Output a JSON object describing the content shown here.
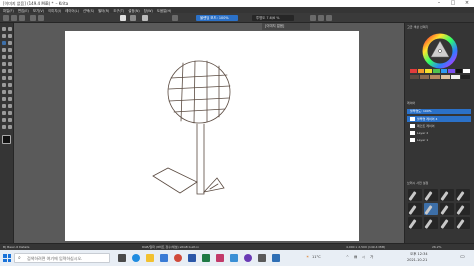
{
  "window": {
    "title": "[이미지 없음] (149.4 MiB) *",
    "app_name": "Krita",
    "controls": [
      "–",
      "□",
      "×"
    ]
  },
  "menubar": [
    "파일(F)",
    "편집(E)",
    "보기(V)",
    "이미지(I)",
    "레이어(L)",
    "선택(S)",
    "필터(R)",
    "도구(T)",
    "설정(N)",
    "창(W)",
    "도움말(H)"
  ],
  "toolbar": {
    "blend_mode": "블렌딩 모드: 100%",
    "opacity_label": "투명도 7.6/6 %"
  },
  "document": {
    "tab_label": "[이미지 없음]"
  },
  "right_panel": {
    "color_selector_title": "고급 색상 선택기",
    "layers_title": "레이어",
    "layer_slider": "불투명도: 100%",
    "layers": [
      {
        "name": "불투명 레이어 4",
        "active": true
      },
      {
        "name": "페인트 레이어",
        "active": false
      },
      {
        "name": "Layer 2",
        "active": false
      },
      {
        "name": "Layer 1",
        "active": false
      }
    ],
    "brush_presets_title": "브러시 사전 설정"
  },
  "statusbar": {
    "left": "B) Basic-6 Details",
    "center": "RGB/알파 (8비트 정수/채널) sRGB built-in",
    "right": "4,000 x 2,500 (149.4 MiB)",
    "zoom": "26.2%"
  },
  "taskbar": {
    "search_placeholder": "검색하려면 여기에 입력하십시오.",
    "weather": "11°C",
    "clock_time": "오후 12:34",
    "clock_date": "2021-10-21"
  },
  "colors": {
    "accent": "#2b71c8",
    "canvas_bg": "#ffffff",
    "workspace": "#5a5a5a",
    "panel": "#353535",
    "taskbar": "#e8eef5",
    "stroke": "#5a4a40"
  }
}
